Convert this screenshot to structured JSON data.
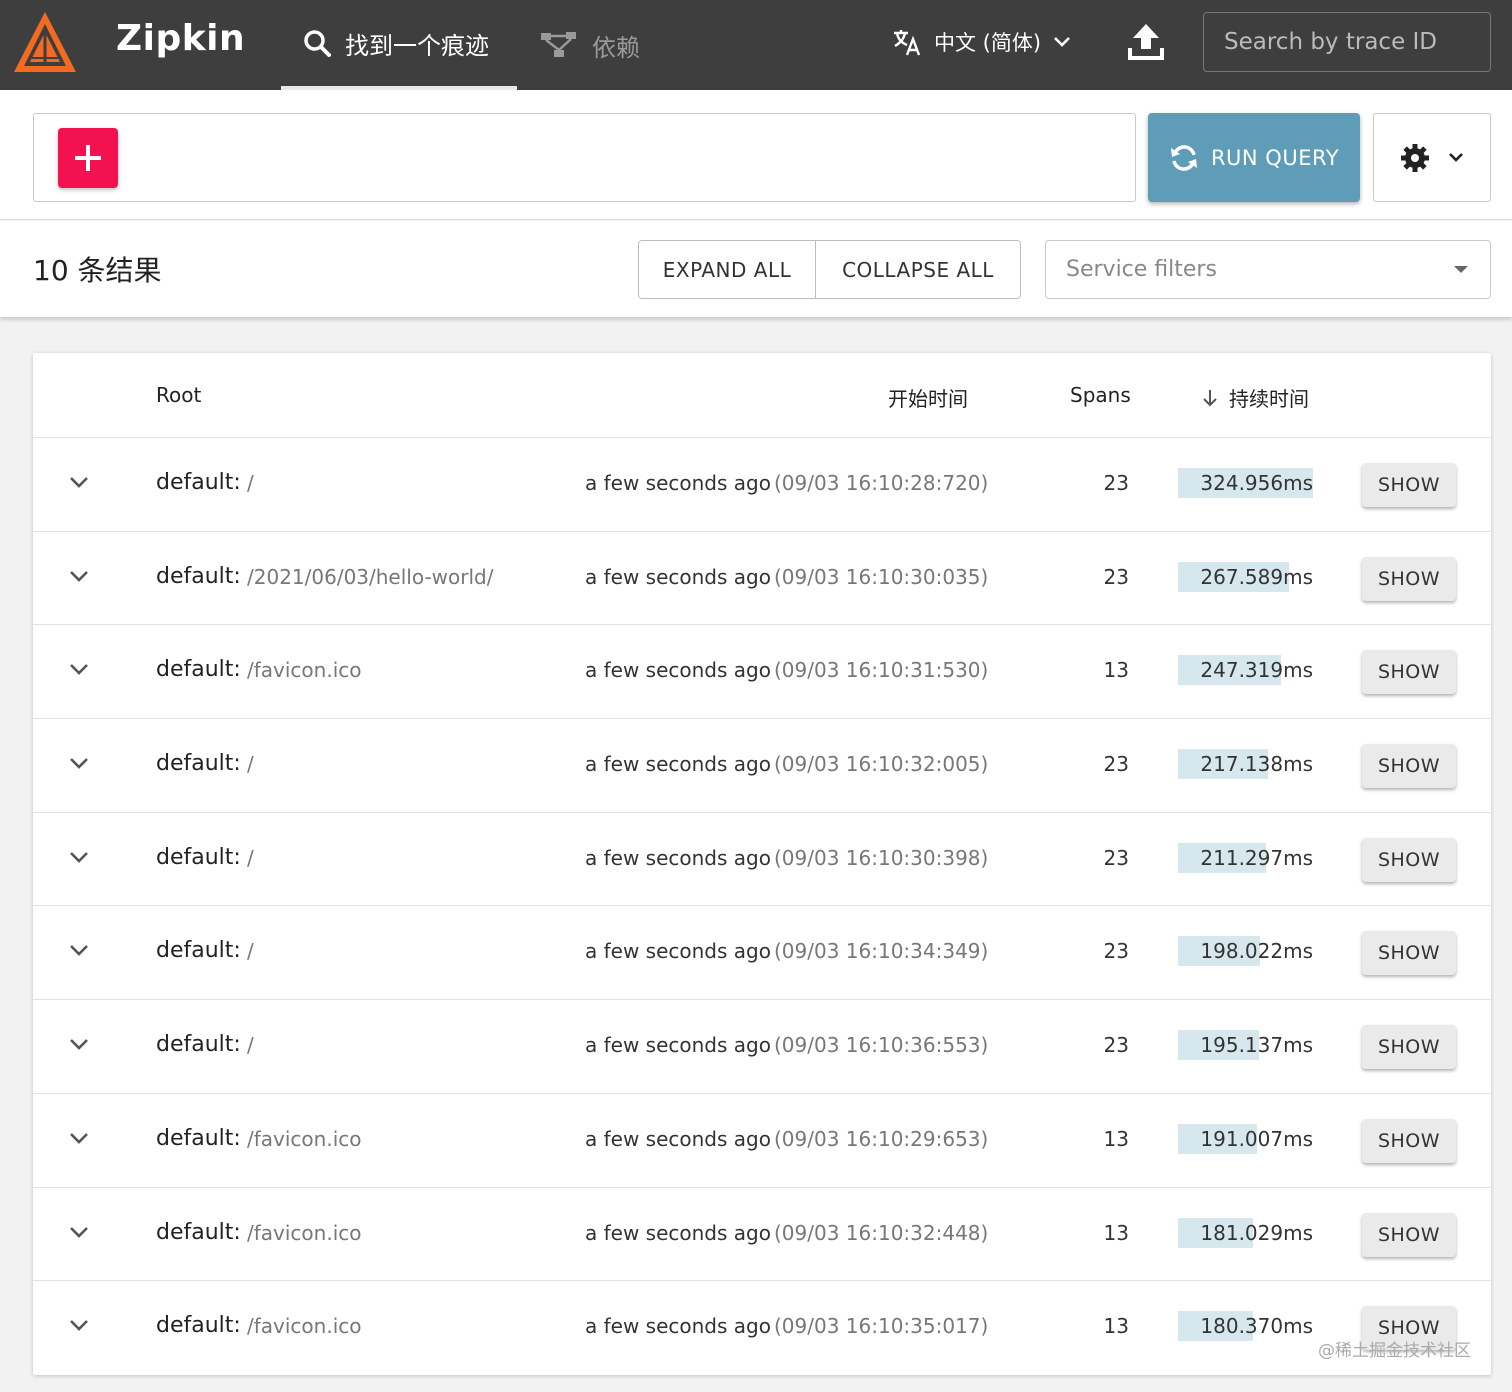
{
  "header": {
    "brand": "Zipkin",
    "nav_find_label": "找到一个痕迹",
    "nav_dependencies_label": "依赖",
    "language_label": "中文 (简体)",
    "trace_search_placeholder": "Search by trace ID"
  },
  "query": {
    "run_label": "RUN QUERY"
  },
  "results": {
    "count_label": "10 条结果",
    "expand_all": "EXPAND ALL",
    "collapse_all": "COLLAPSE ALL",
    "service_filter_placeholder": "Service filters"
  },
  "table": {
    "columns": {
      "root": "Root",
      "start_time": "开始时间",
      "spans": "Spans",
      "duration": "持续时间"
    },
    "show_label": "SHOW",
    "rows": [
      {
        "service": "default:",
        "path": "/",
        "ago": "a few seconds ago",
        "timestamp": "(09/03 16:10:28:720)",
        "spans": "23",
        "duration": "324.956ms",
        "duration_fraction": 1.0
      },
      {
        "service": "default:",
        "path": "/2021/06/03/hello-world/",
        "ago": "a few seconds ago",
        "timestamp": "(09/03 16:10:30:035)",
        "spans": "23",
        "duration": "267.589ms",
        "duration_fraction": 0.823
      },
      {
        "service": "default:",
        "path": "/favicon.ico",
        "ago": "a few seconds ago",
        "timestamp": "(09/03 16:10:31:530)",
        "spans": "13",
        "duration": "247.319ms",
        "duration_fraction": 0.761
      },
      {
        "service": "default:",
        "path": "/",
        "ago": "a few seconds ago",
        "timestamp": "(09/03 16:10:32:005)",
        "spans": "23",
        "duration": "217.138ms",
        "duration_fraction": 0.668
      },
      {
        "service": "default:",
        "path": "/",
        "ago": "a few seconds ago",
        "timestamp": "(09/03 16:10:30:398)",
        "spans": "23",
        "duration": "211.297ms",
        "duration_fraction": 0.65
      },
      {
        "service": "default:",
        "path": "/",
        "ago": "a few seconds ago",
        "timestamp": "(09/03 16:10:34:349)",
        "spans": "23",
        "duration": "198.022ms",
        "duration_fraction": 0.609
      },
      {
        "service": "default:",
        "path": "/",
        "ago": "a few seconds ago",
        "timestamp": "(09/03 16:10:36:553)",
        "spans": "23",
        "duration": "195.137ms",
        "duration_fraction": 0.6
      },
      {
        "service": "default:",
        "path": "/favicon.ico",
        "ago": "a few seconds ago",
        "timestamp": "(09/03 16:10:29:653)",
        "spans": "13",
        "duration": "191.007ms",
        "duration_fraction": 0.588
      },
      {
        "service": "default:",
        "path": "/favicon.ico",
        "ago": "a few seconds ago",
        "timestamp": "(09/03 16:10:32:448)",
        "spans": "13",
        "duration": "181.029ms",
        "duration_fraction": 0.557
      },
      {
        "service": "default:",
        "path": "/favicon.ico",
        "ago": "a few seconds ago",
        "timestamp": "(09/03 16:10:35:017)",
        "spans": "13",
        "duration": "180.370ms",
        "duration_fraction": 0.555
      }
    ]
  },
  "watermark": "@稀土掘金技术社区",
  "colors": {
    "header_bg": "#3e3e3e",
    "logo_orange": "#f36b21",
    "add_button": "#f3114f",
    "run_button": "#5e9cb7",
    "duration_bar": "#d6e8ee"
  },
  "icons": [
    "zipkin-logo-icon",
    "search-icon",
    "dependencies-icon",
    "translate-icon",
    "chevron-down-icon",
    "upload-icon",
    "plus-icon",
    "refresh-icon",
    "gear-icon",
    "arrow-down-icon",
    "expand-row-icon"
  ]
}
